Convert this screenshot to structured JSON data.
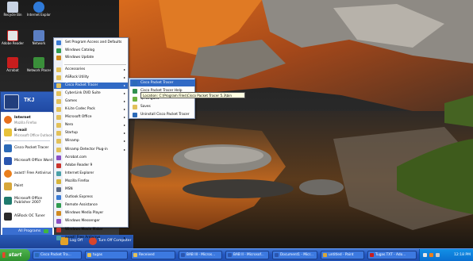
{
  "desktop": {
    "icons": [
      {
        "label": "Recycle Bin"
      },
      {
        "label": "Internet Explorer"
      },
      {
        "label": "Adobe Reader"
      },
      {
        "label": "Network"
      },
      {
        "label": "Acrobat"
      },
      {
        "label": "Network Places"
      }
    ]
  },
  "start_menu": {
    "user_name": "TKJ",
    "pinned": [
      {
        "title": "Internet",
        "subtitle": "Mozilla Firefox"
      },
      {
        "title": "E-mail",
        "subtitle": "Microsoft Office Outlook"
      },
      {
        "title": "Cisco Packet Tracer",
        "subtitle": ""
      },
      {
        "title": "Microsoft Office Word",
        "subtitle": ""
      },
      {
        "title": "avast! Free Antivirus",
        "subtitle": ""
      },
      {
        "title": "Paint",
        "subtitle": ""
      },
      {
        "title": "Microsoft Office Publisher 2007",
        "subtitle": ""
      },
      {
        "title": "ASRock OC Tuner",
        "subtitle": ""
      }
    ],
    "all_programs": "All Programs",
    "log_off": "Log Off",
    "turn_off": "Turn Off Computer"
  },
  "programs_menu": {
    "top_items": [
      "Set Program Access and Defaults",
      "Windows Catalog",
      "Windows Update"
    ],
    "items": [
      {
        "label": "Accessories",
        "submenu": true
      },
      {
        "label": "ASRock Utility",
        "submenu": true
      },
      {
        "label": "Cisco Packet Tracer",
        "submenu": true,
        "highlighted": true
      },
      {
        "label": "CyberLink DVD Suite",
        "submenu": true
      },
      {
        "label": "Games",
        "submenu": true
      },
      {
        "label": "K-Lite Codec Pack",
        "submenu": true
      },
      {
        "label": "Microsoft Office",
        "submenu": true
      },
      {
        "label": "Nero",
        "submenu": true
      },
      {
        "label": "Startup",
        "submenu": true
      },
      {
        "label": "Winamp",
        "submenu": true
      },
      {
        "label": "Winamp Detector Plug-in",
        "submenu": true
      },
      {
        "label": "Acrobat.com",
        "submenu": false
      },
      {
        "label": "Adobe Reader 9",
        "submenu": false
      },
      {
        "label": "Internet Explorer",
        "submenu": false
      },
      {
        "label": "Mozilla Firefox",
        "submenu": false
      },
      {
        "label": "MSN",
        "submenu": false
      },
      {
        "label": "Outlook Express",
        "submenu": false
      },
      {
        "label": "Remote Assistance",
        "submenu": false
      },
      {
        "label": "Windows Media Player",
        "submenu": false
      },
      {
        "label": "Windows Messenger",
        "submenu": false
      },
      {
        "label": "Windows Movie Maker",
        "submenu": false
      },
      {
        "label": "avast! Free Antivirus",
        "submenu": true
      }
    ]
  },
  "submenu": {
    "items": [
      {
        "label": "Cisco Packet Tracer",
        "highlighted": true
      },
      {
        "label": "Cisco Packet Tracer Help"
      },
      {
        "label": "Qt Linguist"
      },
      {
        "label": "Saves"
      },
      {
        "label": "Uninstall Cisco Packet Tracer"
      }
    ],
    "tooltip": "Location: C:\\Program Files\\Cisco Packet Tracer 5.3\\bin"
  },
  "taskbar": {
    "start_label": "start",
    "tasks": [
      {
        "label": "Cisco Packet Tra..."
      },
      {
        "label": "tugas"
      },
      {
        "label": "Received"
      },
      {
        "label": "BAB III - Micros..."
      },
      {
        "label": "BAB II - Microsof..."
      },
      {
        "label": "Document1 - Micr..."
      },
      {
        "label": "untitled - Paint"
      },
      {
        "label": "Tugas.TXT - Ado..."
      }
    ],
    "clock": "12:18 PM"
  }
}
